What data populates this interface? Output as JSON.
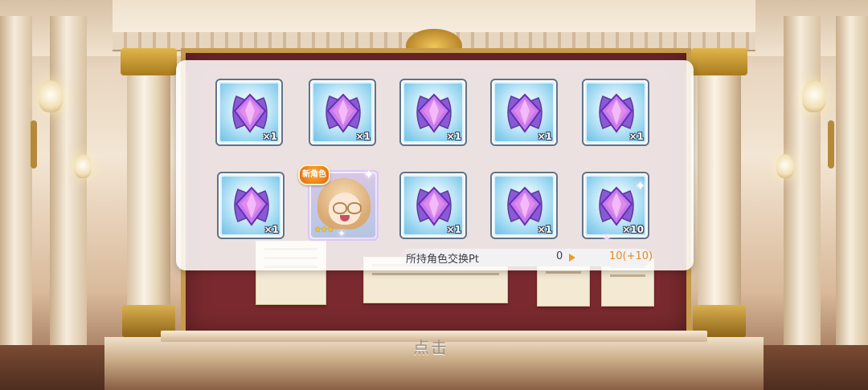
{
  "rewards": {
    "items": [
      {
        "type": "jewel",
        "qty": "×1"
      },
      {
        "type": "jewel",
        "qty": "×1"
      },
      {
        "type": "jewel",
        "qty": "×1"
      },
      {
        "type": "jewel",
        "qty": "×1"
      },
      {
        "type": "jewel",
        "qty": "×1"
      },
      {
        "type": "jewel",
        "qty": "×1"
      },
      {
        "type": "character",
        "badge": "新角色",
        "stars": "★★★"
      },
      {
        "type": "jewel",
        "qty": "×1"
      },
      {
        "type": "jewel",
        "qty": "×1"
      },
      {
        "type": "jewel",
        "qty": "×10"
      }
    ]
  },
  "exchange_pt": {
    "label": "所持角色交换Pt",
    "current": "0",
    "next": "10(+10)"
  },
  "tap_prompt": "点击",
  "colors": {
    "jewel_tile_bg": "#8dd0ee",
    "accent_orange": "#f29a1e",
    "board_red": "#7a2a2e"
  }
}
